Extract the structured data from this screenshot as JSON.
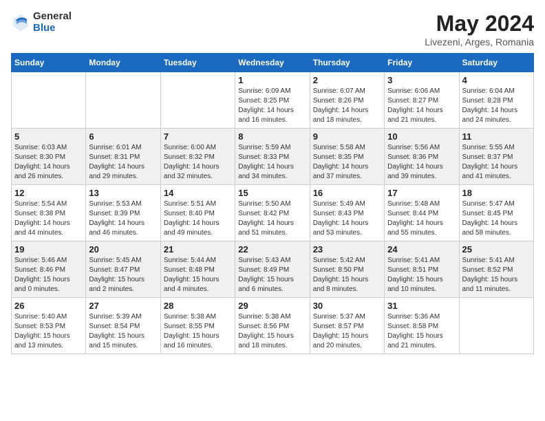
{
  "header": {
    "logo_general": "General",
    "logo_blue": "Blue",
    "month_year": "May 2024",
    "location": "Livezeni, Arges, Romania"
  },
  "weekdays": [
    "Sunday",
    "Monday",
    "Tuesday",
    "Wednesday",
    "Thursday",
    "Friday",
    "Saturday"
  ],
  "weeks": [
    [
      {
        "day": "",
        "sunrise": "",
        "sunset": "",
        "daylight": ""
      },
      {
        "day": "",
        "sunrise": "",
        "sunset": "",
        "daylight": ""
      },
      {
        "day": "",
        "sunrise": "",
        "sunset": "",
        "daylight": ""
      },
      {
        "day": "1",
        "sunrise": "Sunrise: 6:09 AM",
        "sunset": "Sunset: 8:25 PM",
        "daylight": "Daylight: 14 hours and 16 minutes."
      },
      {
        "day": "2",
        "sunrise": "Sunrise: 6:07 AM",
        "sunset": "Sunset: 8:26 PM",
        "daylight": "Daylight: 14 hours and 18 minutes."
      },
      {
        "day": "3",
        "sunrise": "Sunrise: 6:06 AM",
        "sunset": "Sunset: 8:27 PM",
        "daylight": "Daylight: 14 hours and 21 minutes."
      },
      {
        "day": "4",
        "sunrise": "Sunrise: 6:04 AM",
        "sunset": "Sunset: 8:28 PM",
        "daylight": "Daylight: 14 hours and 24 minutes."
      }
    ],
    [
      {
        "day": "5",
        "sunrise": "Sunrise: 6:03 AM",
        "sunset": "Sunset: 8:30 PM",
        "daylight": "Daylight: 14 hours and 26 minutes."
      },
      {
        "day": "6",
        "sunrise": "Sunrise: 6:01 AM",
        "sunset": "Sunset: 8:31 PM",
        "daylight": "Daylight: 14 hours and 29 minutes."
      },
      {
        "day": "7",
        "sunrise": "Sunrise: 6:00 AM",
        "sunset": "Sunset: 8:32 PM",
        "daylight": "Daylight: 14 hours and 32 minutes."
      },
      {
        "day": "8",
        "sunrise": "Sunrise: 5:59 AM",
        "sunset": "Sunset: 8:33 PM",
        "daylight": "Daylight: 14 hours and 34 minutes."
      },
      {
        "day": "9",
        "sunrise": "Sunrise: 5:58 AM",
        "sunset": "Sunset: 8:35 PM",
        "daylight": "Daylight: 14 hours and 37 minutes."
      },
      {
        "day": "10",
        "sunrise": "Sunrise: 5:56 AM",
        "sunset": "Sunset: 8:36 PM",
        "daylight": "Daylight: 14 hours and 39 minutes."
      },
      {
        "day": "11",
        "sunrise": "Sunrise: 5:55 AM",
        "sunset": "Sunset: 8:37 PM",
        "daylight": "Daylight: 14 hours and 41 minutes."
      }
    ],
    [
      {
        "day": "12",
        "sunrise": "Sunrise: 5:54 AM",
        "sunset": "Sunset: 8:38 PM",
        "daylight": "Daylight: 14 hours and 44 minutes."
      },
      {
        "day": "13",
        "sunrise": "Sunrise: 5:53 AM",
        "sunset": "Sunset: 8:39 PM",
        "daylight": "Daylight: 14 hours and 46 minutes."
      },
      {
        "day": "14",
        "sunrise": "Sunrise: 5:51 AM",
        "sunset": "Sunset: 8:40 PM",
        "daylight": "Daylight: 14 hours and 49 minutes."
      },
      {
        "day": "15",
        "sunrise": "Sunrise: 5:50 AM",
        "sunset": "Sunset: 8:42 PM",
        "daylight": "Daylight: 14 hours and 51 minutes."
      },
      {
        "day": "16",
        "sunrise": "Sunrise: 5:49 AM",
        "sunset": "Sunset: 8:43 PM",
        "daylight": "Daylight: 14 hours and 53 minutes."
      },
      {
        "day": "17",
        "sunrise": "Sunrise: 5:48 AM",
        "sunset": "Sunset: 8:44 PM",
        "daylight": "Daylight: 14 hours and 55 minutes."
      },
      {
        "day": "18",
        "sunrise": "Sunrise: 5:47 AM",
        "sunset": "Sunset: 8:45 PM",
        "daylight": "Daylight: 14 hours and 58 minutes."
      }
    ],
    [
      {
        "day": "19",
        "sunrise": "Sunrise: 5:46 AM",
        "sunset": "Sunset: 8:46 PM",
        "daylight": "Daylight: 15 hours and 0 minutes."
      },
      {
        "day": "20",
        "sunrise": "Sunrise: 5:45 AM",
        "sunset": "Sunset: 8:47 PM",
        "daylight": "Daylight: 15 hours and 2 minutes."
      },
      {
        "day": "21",
        "sunrise": "Sunrise: 5:44 AM",
        "sunset": "Sunset: 8:48 PM",
        "daylight": "Daylight: 15 hours and 4 minutes."
      },
      {
        "day": "22",
        "sunrise": "Sunrise: 5:43 AM",
        "sunset": "Sunset: 8:49 PM",
        "daylight": "Daylight: 15 hours and 6 minutes."
      },
      {
        "day": "23",
        "sunrise": "Sunrise: 5:42 AM",
        "sunset": "Sunset: 8:50 PM",
        "daylight": "Daylight: 15 hours and 8 minutes."
      },
      {
        "day": "24",
        "sunrise": "Sunrise: 5:41 AM",
        "sunset": "Sunset: 8:51 PM",
        "daylight": "Daylight: 15 hours and 10 minutes."
      },
      {
        "day": "25",
        "sunrise": "Sunrise: 5:41 AM",
        "sunset": "Sunset: 8:52 PM",
        "daylight": "Daylight: 15 hours and 11 minutes."
      }
    ],
    [
      {
        "day": "26",
        "sunrise": "Sunrise: 5:40 AM",
        "sunset": "Sunset: 8:53 PM",
        "daylight": "Daylight: 15 hours and 13 minutes."
      },
      {
        "day": "27",
        "sunrise": "Sunrise: 5:39 AM",
        "sunset": "Sunset: 8:54 PM",
        "daylight": "Daylight: 15 hours and 15 minutes."
      },
      {
        "day": "28",
        "sunrise": "Sunrise: 5:38 AM",
        "sunset": "Sunset: 8:55 PM",
        "daylight": "Daylight: 15 hours and 16 minutes."
      },
      {
        "day": "29",
        "sunrise": "Sunrise: 5:38 AM",
        "sunset": "Sunset: 8:56 PM",
        "daylight": "Daylight: 15 hours and 18 minutes."
      },
      {
        "day": "30",
        "sunrise": "Sunrise: 5:37 AM",
        "sunset": "Sunset: 8:57 PM",
        "daylight": "Daylight: 15 hours and 20 minutes."
      },
      {
        "day": "31",
        "sunrise": "Sunrise: 5:36 AM",
        "sunset": "Sunset: 8:58 PM",
        "daylight": "Daylight: 15 hours and 21 minutes."
      },
      {
        "day": "",
        "sunrise": "",
        "sunset": "",
        "daylight": ""
      }
    ]
  ]
}
